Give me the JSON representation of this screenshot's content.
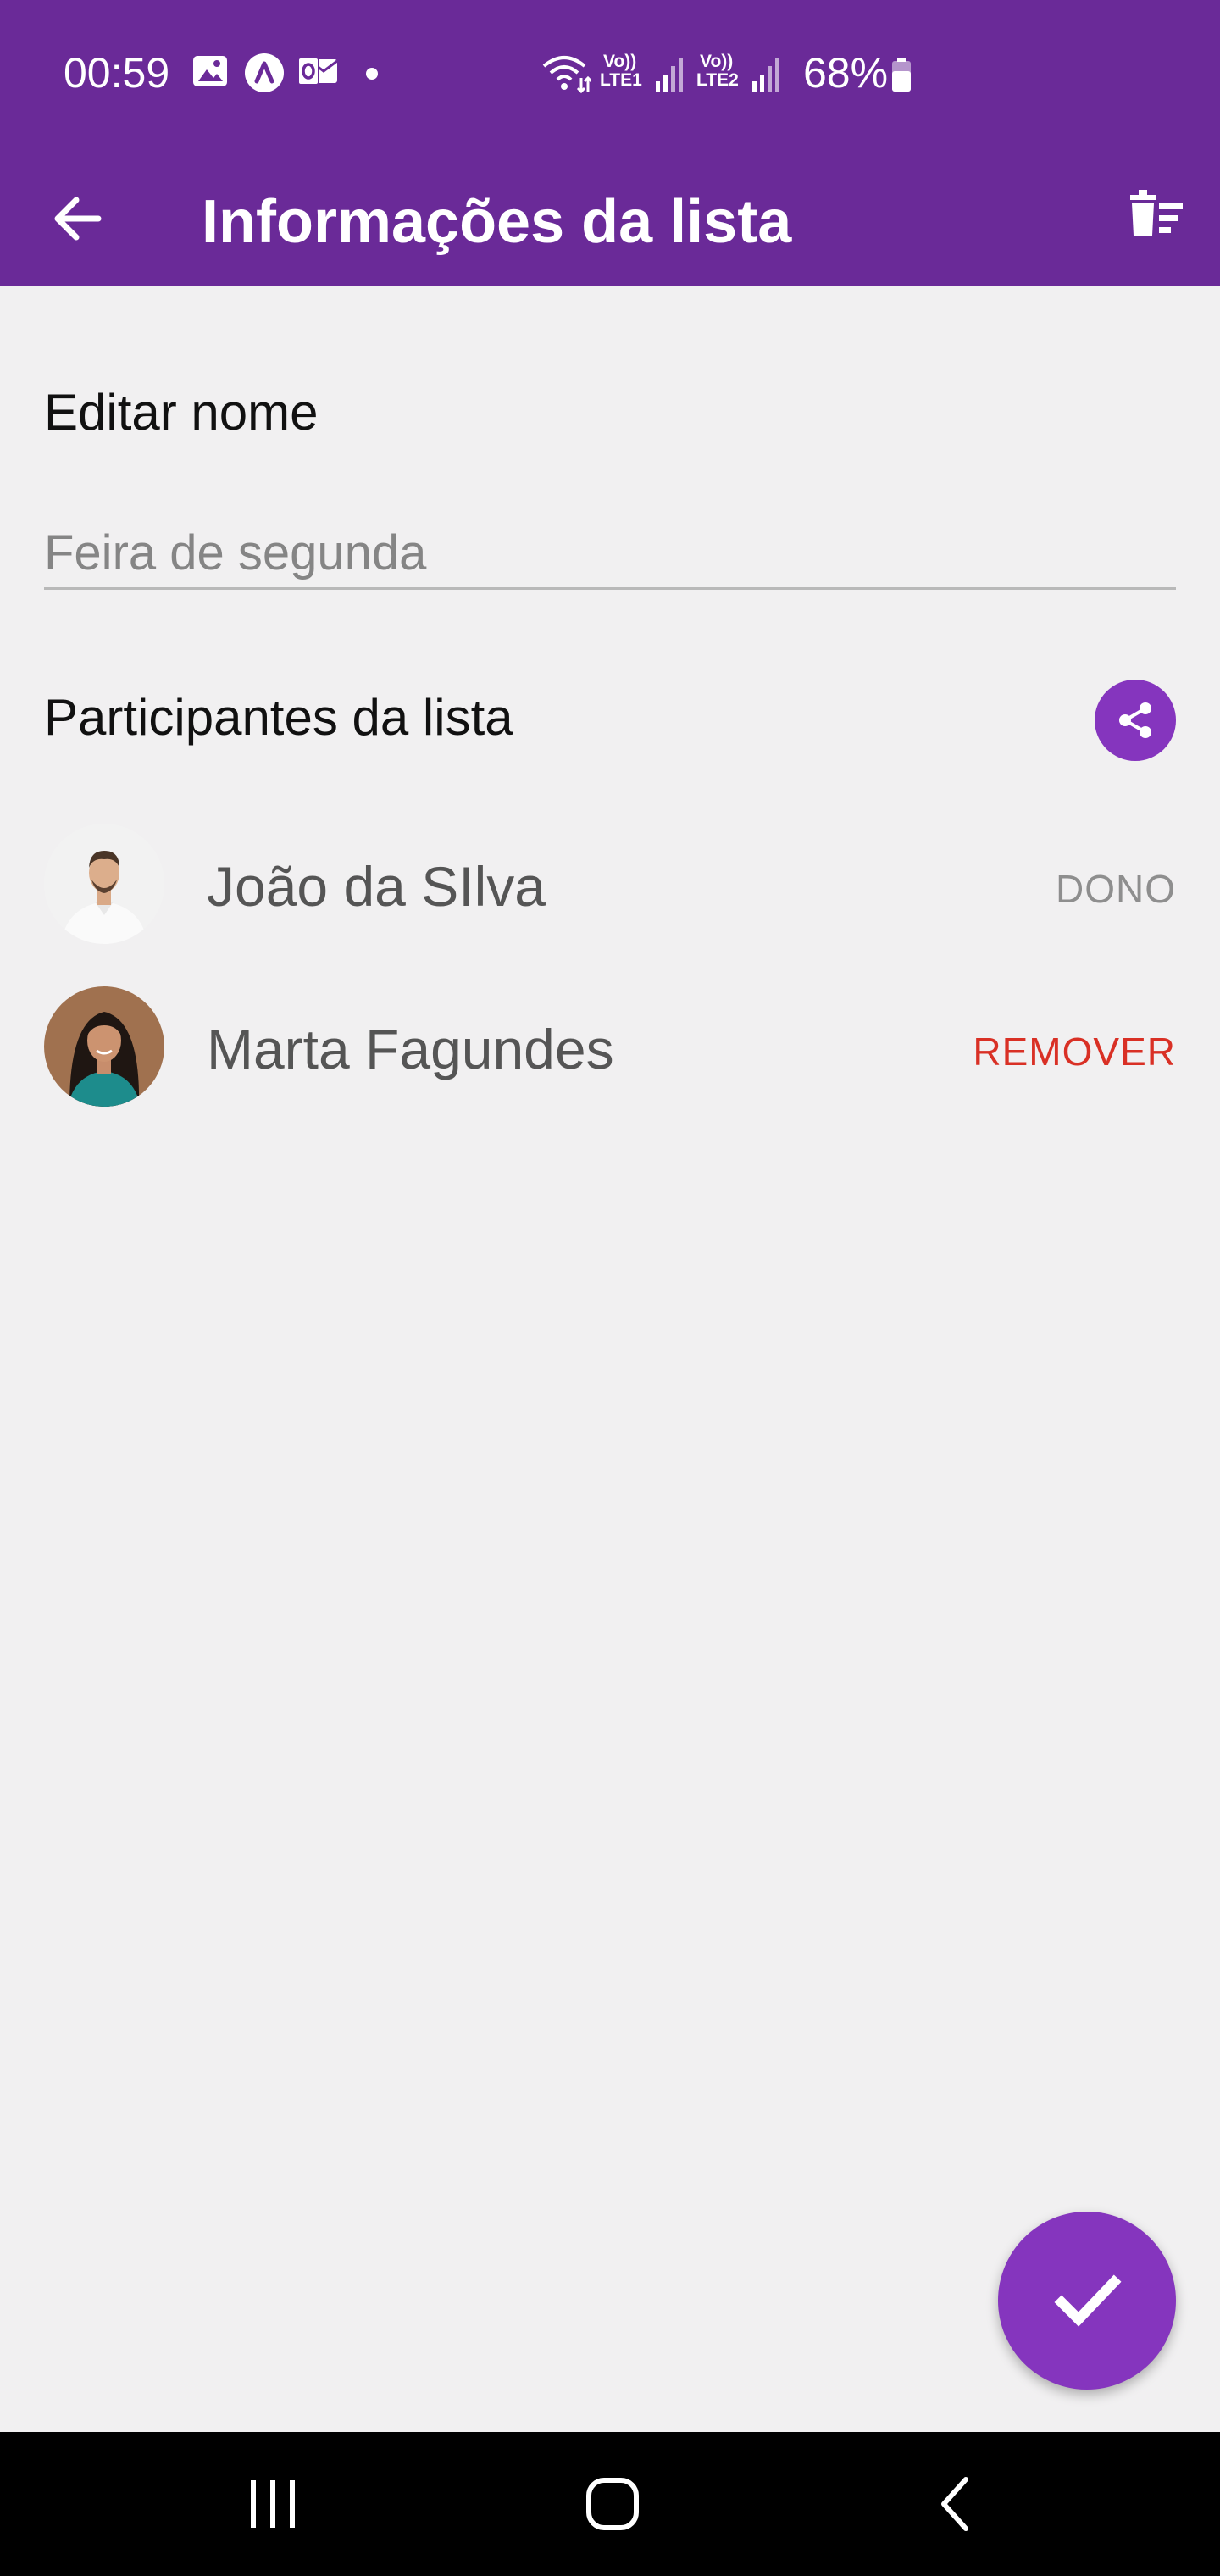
{
  "status_bar": {
    "time": "00:59",
    "battery": "68%",
    "network_1": "LTE1",
    "network_2": "LTE2",
    "icons": [
      "image-icon",
      "app-a-icon",
      "outlook-icon",
      "wifi-icon",
      "signal-icon",
      "battery-icon"
    ]
  },
  "app_bar": {
    "title": "Informações da lista",
    "back_icon": "arrow-left-icon",
    "delete_icon": "delete-list-icon"
  },
  "edit_name": {
    "label": "Editar nome",
    "placeholder": "Feira de segunda",
    "value": ""
  },
  "participants": {
    "label": "Participantes da lista",
    "share_icon": "share-icon",
    "items": [
      {
        "name": "João da SIlva",
        "role_label": "DONO",
        "action": "owner"
      },
      {
        "name": "Marta Fagundes",
        "role_label": "REMOVER",
        "action": "remove"
      }
    ]
  },
  "fab": {
    "icon": "check-icon"
  },
  "nav_bar": {
    "recent_icon": "recent-apps-icon",
    "home_icon": "home-icon",
    "back_icon": "back-icon"
  },
  "colors": {
    "primary": "#6a2a98",
    "accent": "#8535be",
    "remove": "#d93025",
    "background": "#f1f0f1"
  }
}
